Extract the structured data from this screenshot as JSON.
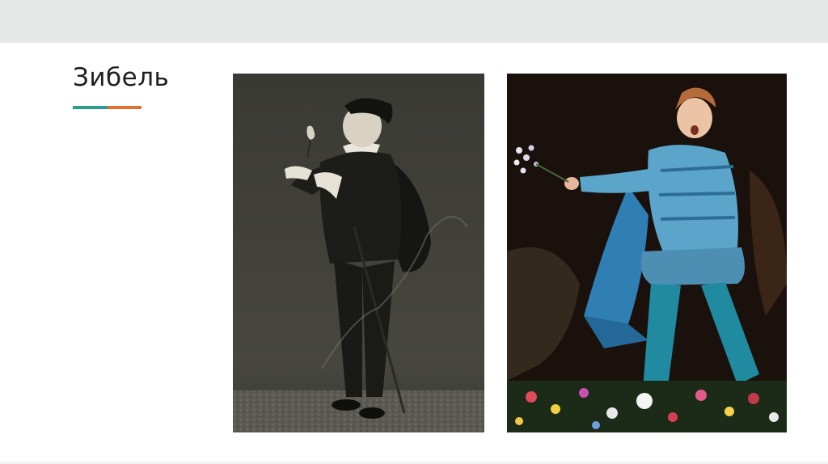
{
  "slide": {
    "title": "Зибель"
  },
  "colors": {
    "top_band": "#e6e8e8",
    "underline_teal": "#2a9d8f",
    "underline_orange": "#e76f2d"
  },
  "images": [
    {
      "name": "left-photo",
      "description_icon": "sepia-portrait-photo"
    },
    {
      "name": "right-photo",
      "description_icon": "stage-performance-photo"
    }
  ]
}
